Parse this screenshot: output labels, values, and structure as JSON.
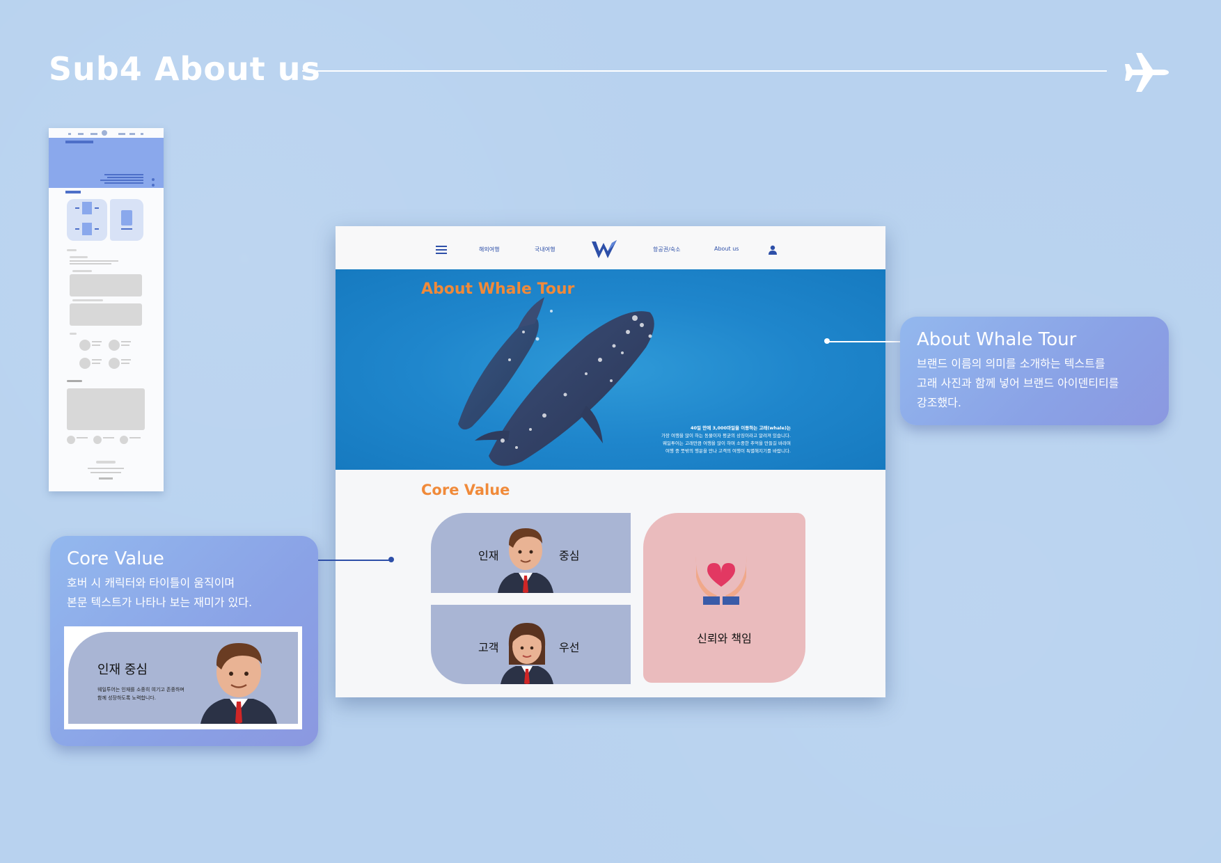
{
  "page": {
    "title": "Sub4 About us"
  },
  "mockup": {
    "nav": {
      "items": [
        "해외여행",
        "국내여행",
        "항공권/숙소",
        "About us"
      ]
    },
    "hero": {
      "title": "About Whale Tour",
      "text_lines": [
        "40일 만에 3,000마일을 이동하는 고래(whale)는",
        "가장 여행을 많이 하는 동물이자 평균의 상징이라고 알려져 있습니다.",
        "웨일투어는 고래만큼 여행을 많이 하며 소중한 추억을 만들길 바라며",
        "여행 중 뜻밖의 행운을 만나 고객의 여행이 특별해지기를 바랍니다."
      ]
    },
    "core_value": {
      "title": "Core Value",
      "cards": [
        {
          "left": "인재",
          "right": "중심"
        },
        {
          "left": "고객",
          "right": "우선"
        }
      ],
      "trust_label": "신뢰와 책임"
    }
  },
  "callouts": {
    "about": {
      "title": "About Whale Tour",
      "desc": [
        "브랜드 이름의 의미를 소개하는 텍스트를",
        "고래 사진과 함께 넣어 브랜드 아이덴티티를",
        "강조했다."
      ]
    },
    "core": {
      "title": "Core Value",
      "desc": [
        "호버 시 캐릭터와 타이틀이 움직이며",
        "본문 텍스트가 나타나 보는 재미가 있다."
      ],
      "preview": {
        "title": "인재  중심",
        "lines": [
          "웨일투어는 인재를 소중히 여기고 존중하며",
          "함께 성장하도록 노력합니다."
        ]
      }
    }
  },
  "colors": {
    "background": "#b8d2ef",
    "accent_orange": "#f08a3a",
    "brand_blue": "#2d4fa8",
    "card_blue": "#a9b5d4",
    "card_pink": "#eabbbd"
  },
  "icons": [
    "airplane-icon",
    "menu-icon",
    "whale-logo-icon",
    "user-icon",
    "heart-hands-icon",
    "businessman-avatar",
    "businesswoman-avatar"
  ]
}
